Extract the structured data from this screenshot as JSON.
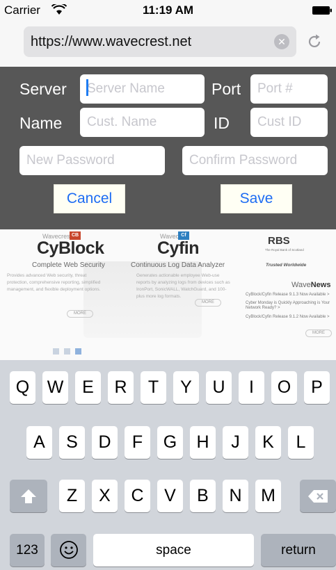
{
  "status_bar": {
    "carrier": "Carrier",
    "time": "11:19 AM"
  },
  "browser": {
    "url": "https://www.wavecrest.net"
  },
  "settings_form": {
    "server_label": "Server",
    "server_placeholder": "Server Name",
    "port_label": "Port",
    "port_placeholder": "Port #",
    "name_label": "Name",
    "name_placeholder": "Cust. Name",
    "id_label": "ID",
    "id_placeholder": "Cust ID",
    "new_password_placeholder": "New Password",
    "confirm_password_placeholder": "Confirm Password",
    "cancel_label": "Cancel",
    "save_label": "Save"
  },
  "webpage": {
    "cyblock": {
      "maker": "Wavecrest",
      "badge": "CB",
      "name": "CyBlock",
      "tagline": "Complete Web Security",
      "description": "Provides advanced Web security, threat protection, comprehensive reporting, simplified management, and flexible deployment options.",
      "more": "MORE"
    },
    "cyfin": {
      "maker": "Wavecrest",
      "badge": "Cf",
      "name": "Cyfin",
      "tagline": "Continuous Log Data Analyzer",
      "description": "Generates actionable employee Web-use reports by analyzing logs from devices such as IronPort, SonicWALL, WatchGuard, and 100-plus more log formats.",
      "more": "MORE"
    },
    "rbs": {
      "logo": "RBS",
      "subtitle": "The Royal Bank of Scotland",
      "tagline": "Trusted Worldwide"
    },
    "news": {
      "title_prefix": "Wave",
      "title_suffix": "News",
      "items": [
        "CyBlock/Cyfin Release 9.1.3 Now Available >",
        "Cyber Monday is Quickly Approaching is Your",
        "Network Ready? >",
        "CyBlock/Cyfin Release 9.1.2 Now Available >"
      ],
      "more": "MORE"
    }
  },
  "keyboard": {
    "row1": [
      "Q",
      "W",
      "E",
      "R",
      "T",
      "Y",
      "U",
      "I",
      "O",
      "P"
    ],
    "row2": [
      "A",
      "S",
      "D",
      "F",
      "G",
      "H",
      "J",
      "K",
      "L"
    ],
    "row3": [
      "Z",
      "X",
      "C",
      "V",
      "B",
      "N",
      "M"
    ],
    "numbers_label": "123",
    "space_label": "space",
    "return_label": "return"
  },
  "colors": {
    "accent": "#1d6cf3",
    "panel": "#575757",
    "keyboard": "#d1d5db"
  }
}
